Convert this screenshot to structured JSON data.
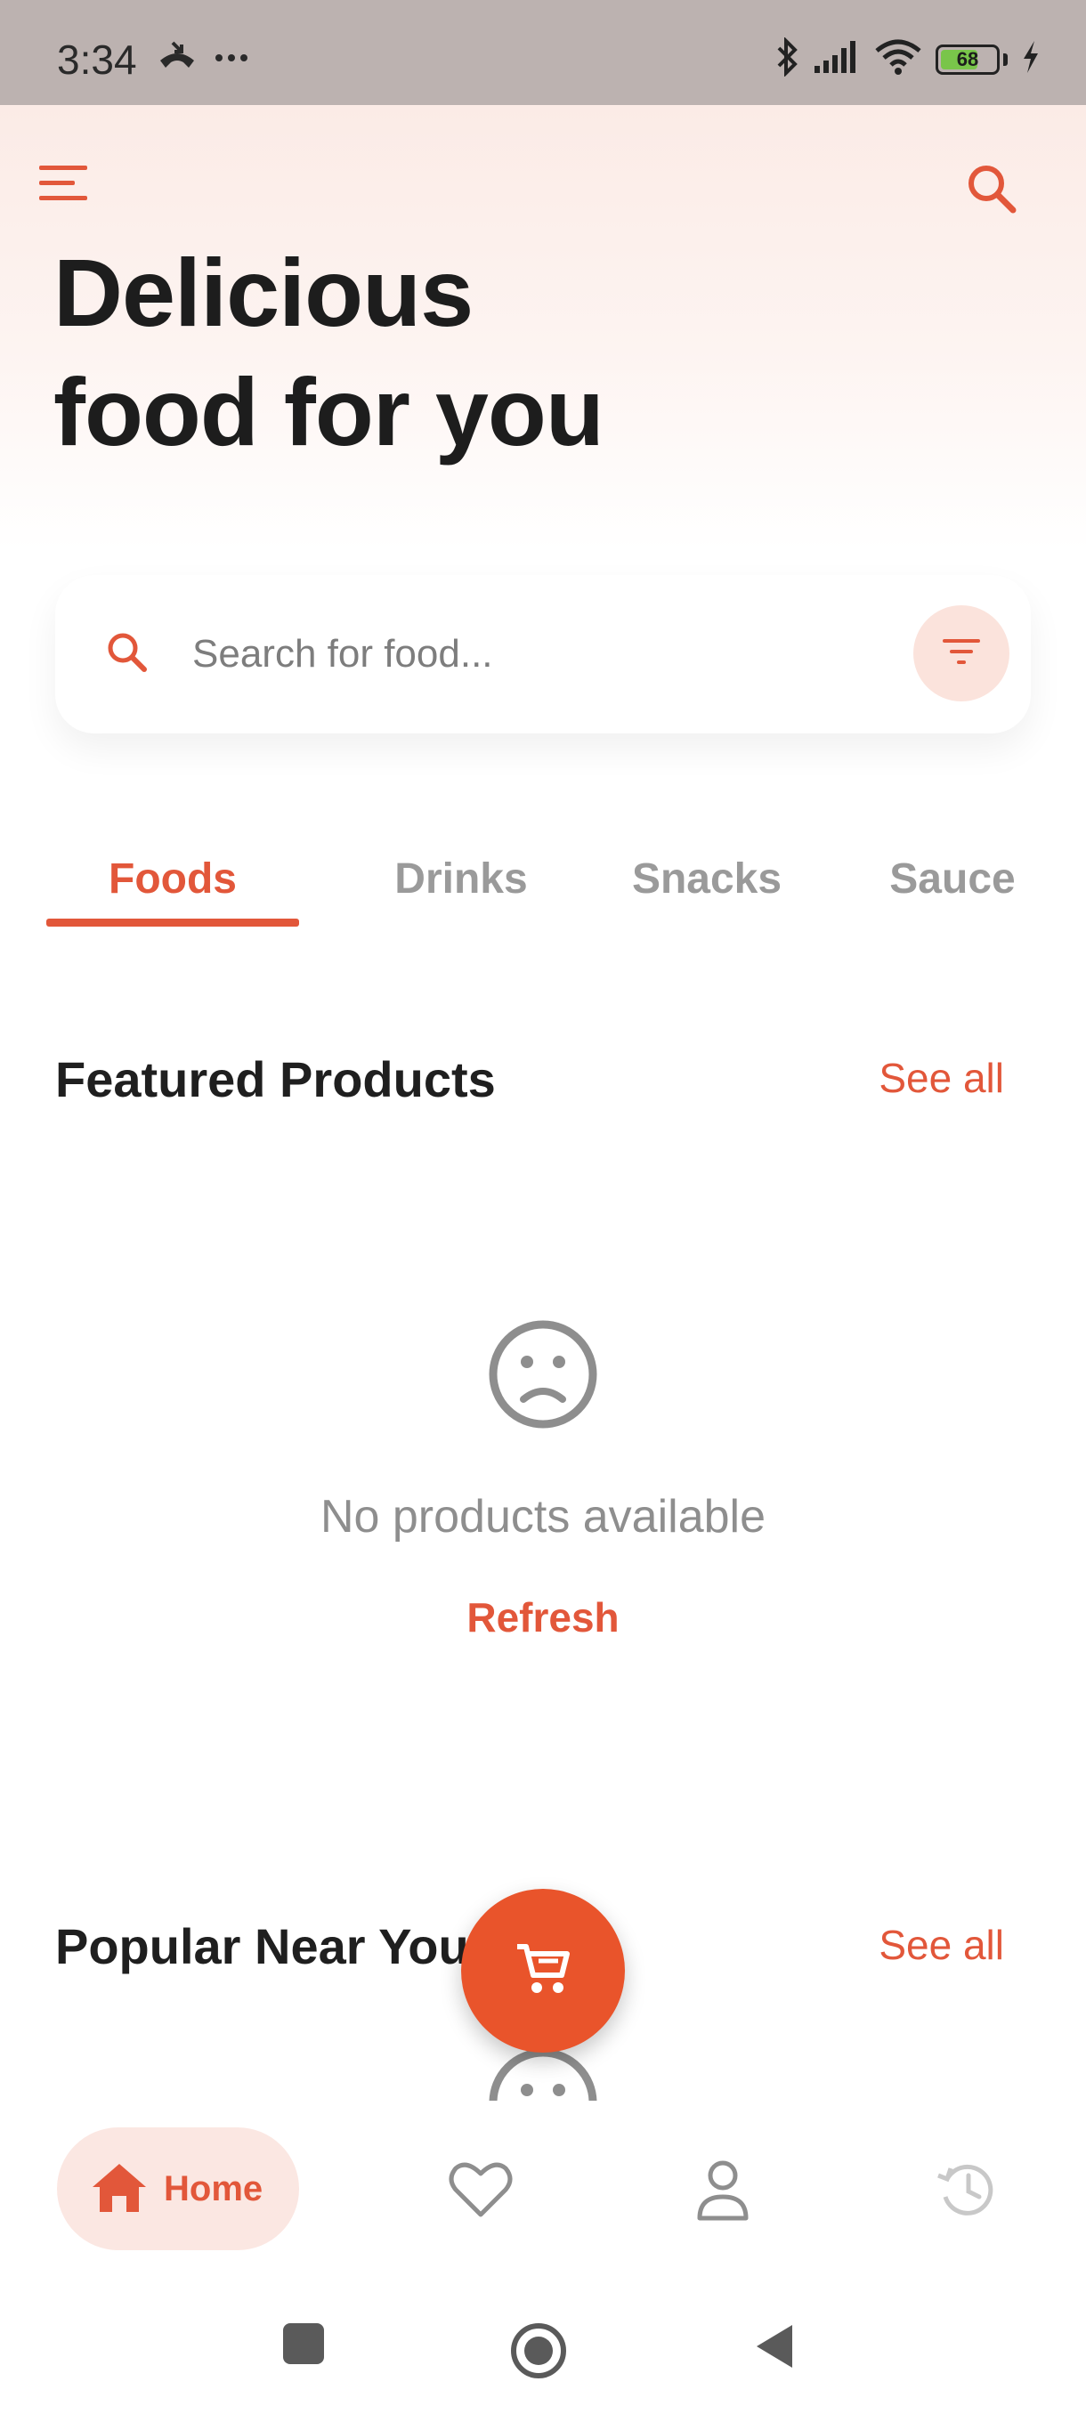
{
  "status_bar": {
    "time": "3:34",
    "battery": "68",
    "icons": [
      "missed-call-icon",
      "more-dots-icon",
      "bluetooth-icon",
      "signal-icon",
      "wifi-icon",
      "battery-icon",
      "charging-icon"
    ]
  },
  "header": {
    "headline_line1": "Delicious",
    "headline_line2": "food for you",
    "icons": [
      "menu-icon",
      "search-icon"
    ]
  },
  "search": {
    "placeholder": "Search for food...",
    "value": ""
  },
  "tabs": [
    {
      "label": "Foods",
      "active": true
    },
    {
      "label": "Drinks",
      "active": false
    },
    {
      "label": "Snacks",
      "active": false
    },
    {
      "label": "Sauce",
      "active": false
    }
  ],
  "featured": {
    "title": "Featured Products",
    "see_all": "See all",
    "empty_message": "No products available",
    "refresh_label": "Refresh"
  },
  "popular": {
    "title": "Popular Near You",
    "see_all": "See all"
  },
  "bottom_nav": {
    "home_label": "Home",
    "items": [
      "home-icon",
      "heart-icon",
      "profile-icon",
      "history-icon"
    ]
  },
  "colors": {
    "accent": "#e2573a",
    "fab": "#e9542b",
    "status_bar": "#bcb2b0",
    "battery_fill": "#79c54a"
  }
}
